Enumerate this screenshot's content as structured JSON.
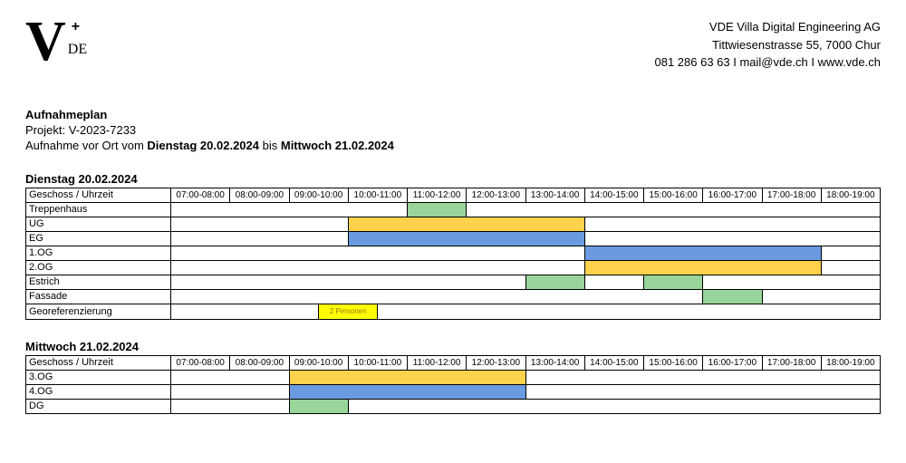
{
  "company": {
    "name": "VDE Villa Digital Engineering AG",
    "address": "Tittwiesenstrasse 55, 7000 Chur",
    "contact": "081 286 63 63 I mail@vde.ch I www.vde.ch"
  },
  "logo": {
    "v": "V",
    "plus": "+",
    "de": "DE"
  },
  "doc": {
    "title": "Aufnahmeplan",
    "project_label": "Projekt:",
    "project_no": "V-2023-7233",
    "date_prefix": "Aufnahme vor Ort vom",
    "date_from": "Dienstag 20.02.2024",
    "date_mid": "bis",
    "date_to": "Mittwoch 21.02.2024"
  },
  "time_slots": [
    "07:00-08:00",
    "08:00-09:00",
    "09:00-10:00",
    "10:00-11:00",
    "11:00-12:00",
    "12:00-13:00",
    "13:00-14:00",
    "14:00-15:00",
    "15:00-16:00",
    "16:00-17:00",
    "17:00-18:00",
    "18:00-19:00"
  ],
  "corner_label": "Geschoss / Uhrzeit",
  "day1": {
    "heading": "Dienstag 20.02.2024",
    "rows": [
      {
        "label": "Treppenhaus",
        "cells": [
          "",
          "",
          "",
          "",
          "",
          "",
          "",
          "",
          "g",
          "g",
          "",
          "",
          "",
          "",
          "",
          "",
          "",
          "",
          "",
          "",
          "",
          "",
          "",
          ""
        ]
      },
      {
        "label": "UG",
        "cells": [
          "",
          "",
          "",
          "",
          "",
          "",
          "y",
          "y",
          "y",
          "y",
          "y",
          "y",
          "y",
          "y",
          "",
          "",
          "",
          "",
          "",
          "",
          "",
          "",
          "",
          ""
        ]
      },
      {
        "label": "EG",
        "cells": [
          "",
          "",
          "",
          "",
          "",
          "",
          "b",
          "b",
          "b",
          "b",
          "b",
          "b",
          "b",
          "b",
          "",
          "",
          "",
          "",
          "",
          "",
          "",
          "",
          "",
          ""
        ]
      },
      {
        "label": "1.OG",
        "cells": [
          "",
          "",
          "",
          "",
          "",
          "",
          "",
          "",
          "",
          "",
          "",
          "",
          "",
          "",
          "b",
          "b",
          "b",
          "b",
          "b",
          "b",
          "b",
          "b",
          "",
          ""
        ]
      },
      {
        "label": "2.OG",
        "cells": [
          "",
          "",
          "",
          "",
          "",
          "",
          "",
          "",
          "",
          "",
          "",
          "",
          "",
          "",
          "y",
          "y",
          "y",
          "y",
          "y",
          "y",
          "y",
          "y",
          "",
          ""
        ]
      },
      {
        "label": "Estrich",
        "cells": [
          "",
          "",
          "",
          "",
          "",
          "",
          "",
          "",
          "",
          "",
          "",
          "",
          "g",
          "g",
          "",
          "",
          "g",
          "g",
          "",
          "",
          "",
          "",
          "",
          ""
        ]
      },
      {
        "label": "Fassade",
        "cells": [
          "",
          "",
          "",
          "",
          "",
          "",
          "",
          "",
          "",
          "",
          "",
          "",
          "",
          "",
          "",
          "",
          "",
          "",
          "g",
          "g",
          "",
          "",
          "",
          ""
        ]
      },
      {
        "label": "Georeferenzierung",
        "note": "2 Personen",
        "cells": [
          "",
          "",
          "",
          "",
          "",
          "N",
          "N",
          "",
          "",
          "",
          "",
          "",
          "",
          "",
          "",
          "",
          "",
          "",
          "",
          "",
          "",
          "",
          "",
          ""
        ]
      }
    ]
  },
  "day2": {
    "heading": "Mittwoch 21.02.2024",
    "rows": [
      {
        "label": "3.OG",
        "cells": [
          "",
          "",
          "",
          "",
          "y",
          "y",
          "y",
          "y",
          "y",
          "y",
          "y",
          "y",
          "",
          "",
          "",
          "",
          "",
          "",
          "",
          "",
          "",
          "",
          "",
          ""
        ]
      },
      {
        "label": "4.OG",
        "cells": [
          "",
          "",
          "",
          "",
          "b",
          "b",
          "b",
          "b",
          "b",
          "b",
          "b",
          "b",
          "",
          "",
          "",
          "",
          "",
          "",
          "",
          "",
          "",
          "",
          "",
          ""
        ]
      },
      {
        "label": "DG",
        "cells": [
          "",
          "",
          "",
          "",
          "g",
          "g",
          "",
          "",
          "",
          "",
          "",
          "",
          "",
          "",
          "",
          "",
          "",
          "",
          "",
          "",
          "",
          "",
          "",
          ""
        ]
      }
    ]
  }
}
